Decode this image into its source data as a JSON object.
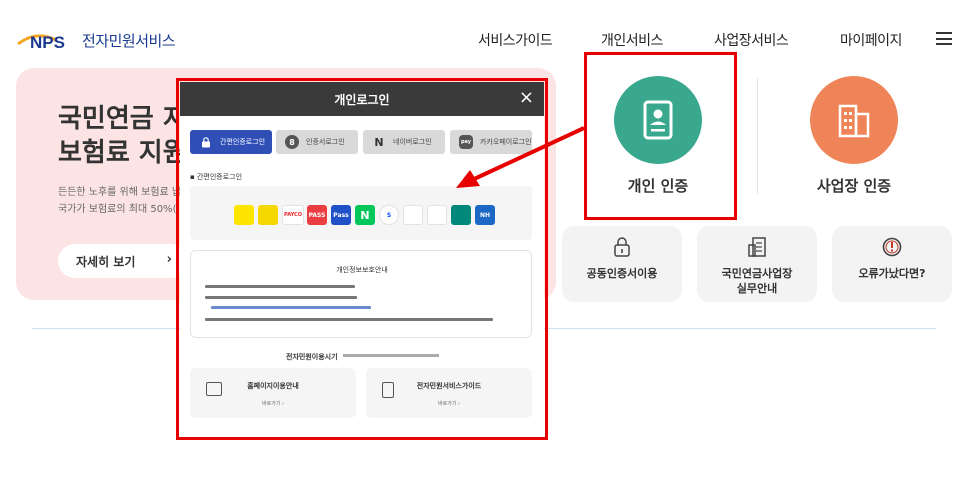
{
  "header": {
    "logo_mark": "NPS",
    "logo_text": "전자민원서비스",
    "nav": [
      "서비스가이드",
      "개인서비스",
      "사업장서비스",
      "마이페이지"
    ]
  },
  "banner": {
    "title": "국민연금 지\n보험료 지원",
    "desc": "든든한 노후를 위해 보험료 납\n국가가 보험료의 최대 50%(",
    "button": "자세히 보기"
  },
  "certs": {
    "personal": "개인 인증",
    "business": "사업장 인증"
  },
  "quick_links": [
    {
      "label": "공동인증서이용",
      "icon": "lock-icon"
    },
    {
      "label": "국민연금사업장\n실무안내",
      "icon": "document-icon"
    },
    {
      "label": "오류가났다면?",
      "icon": "alert-icon"
    }
  ],
  "modal": {
    "title": "개인로그인",
    "close": "×",
    "tabs": [
      {
        "label": "간편인증로그인",
        "icon": "lock-icon"
      },
      {
        "label": "인증서로그인",
        "icon": "certificate-icon"
      },
      {
        "label": "네이버로그인",
        "icon": "naver-icon"
      },
      {
        "label": "카카오페이로그인",
        "icon": "kakaopay-icon"
      }
    ],
    "section_label": "▪ 간편인증로그인",
    "providers": [
      {
        "name": "kakao",
        "text": "",
        "bg": "#fee500",
        "fg": "#3a1d1d"
      },
      {
        "name": "toss",
        "text": "",
        "bg": "#f5d800",
        "fg": "#333333"
      },
      {
        "name": "payco",
        "text": "PAYCO",
        "bg": "#ffffff",
        "fg": "#e8262c"
      },
      {
        "name": "pass-red",
        "text": "PASS",
        "bg": "#ea3e42",
        "fg": "#ffffff"
      },
      {
        "name": "pass-blue",
        "text": "Pass",
        "bg": "#2051c9",
        "fg": "#ffffff"
      },
      {
        "name": "naver",
        "text": "N",
        "bg": "#03c75a",
        "fg": "#ffffff"
      },
      {
        "name": "shinhan",
        "text": "S",
        "bg": "#ffffff",
        "fg": "#0046ff"
      },
      {
        "name": "samsung",
        "text": "",
        "bg": "#ffffff",
        "fg": "#1428a0"
      },
      {
        "name": "banksalad",
        "text": "",
        "bg": "#ffffff",
        "fg": "#00c896"
      },
      {
        "name": "hana",
        "text": "",
        "bg": "#00887b",
        "fg": "#ffffff"
      },
      {
        "name": "nh",
        "text": "NH",
        "bg": "#1d68c4",
        "fg": "#ffffff"
      }
    ],
    "notice_title": "개인정보보호안내",
    "usage_title": "전자민원이용시기",
    "cards": [
      {
        "title": "홈페이지이용안내",
        "sub": "바로가기 ›"
      },
      {
        "title": "전자민원서비스가이드",
        "sub": "바로가기 ›"
      }
    ]
  },
  "colors": {
    "banner_bg": "#fde4e4",
    "personal_green": "#3aa88e",
    "business_orange": "#ef8458",
    "highlight_red": "#e80000",
    "tab_active": "#2f4fb7"
  }
}
